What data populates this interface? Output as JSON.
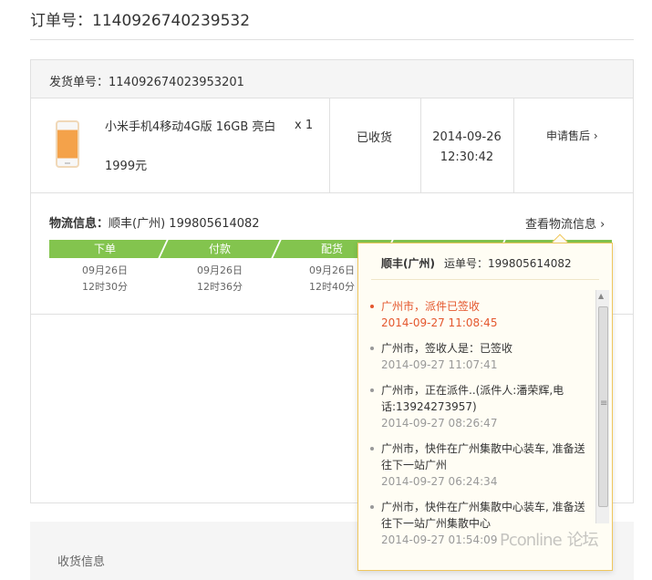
{
  "order": {
    "title": "订单号：1140926740239532"
  },
  "shipment": {
    "label": "发货单号：114092674023953201"
  },
  "item": {
    "name": "小米手机4移动4G版 16GB 亮白",
    "price": "1999元",
    "qty": "x 1",
    "status": "已收货",
    "date": "2014-09-26",
    "time": "12:30:42",
    "aftersale": "申请售后 ›"
  },
  "logistics": {
    "label": "物流信息：",
    "carrier_info": "顺丰(广州) 199805614082",
    "view_link": "查看物流信息 ›",
    "steps": [
      {
        "label": "下单",
        "date": "09月26日",
        "time": "12时30分"
      },
      {
        "label": "付款",
        "date": "09月26日",
        "time": "12时36分"
      },
      {
        "label": "配货",
        "date": "09月26日",
        "time": "12时40分"
      }
    ]
  },
  "popup": {
    "carrier": "顺丰(广州)",
    "waybill": "运单号：199805614082",
    "tracking": [
      {
        "desc": "广州市，派件已签收",
        "time": "2014-09-27 11:08:45"
      },
      {
        "desc": "广州市，签收人是：已签收",
        "time": "2014-09-27 11:07:41"
      },
      {
        "desc": "广州市，正在派件..(派件人:潘荣辉,电话:13924273957)",
        "time": "2014-09-27 08:26:47"
      },
      {
        "desc": "广州市，快件在广州集散中心装车, 准备送往下一站广州",
        "time": "2014-09-27 06:24:34"
      },
      {
        "desc": "广州市，快件在广州集散中心装车, 准备送往下一站广州集散中心",
        "time": "2014-09-27 01:54:09"
      }
    ]
  },
  "address": {
    "label": "收货信息"
  },
  "watermark": {
    "brand": "Pconline",
    "suffix": "论坛"
  },
  "colors": {
    "progress": "#83c44e",
    "latest": "#e4572e",
    "popup_border": "#f0c75e"
  }
}
